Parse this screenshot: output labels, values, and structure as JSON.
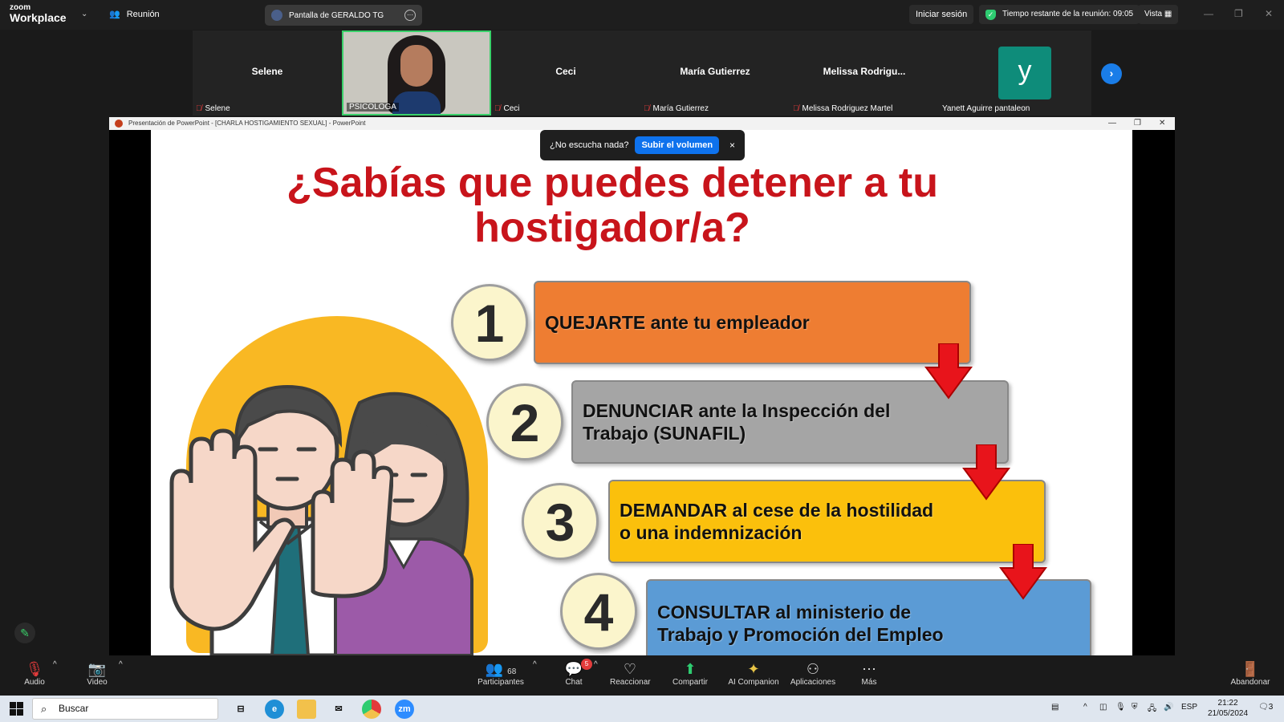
{
  "topbar": {
    "brand_top": "zoom",
    "brand_bottom": "Workplace",
    "meeting_label": "Reunión",
    "share_label": "Pantalla de GERALDO TG",
    "signin_label": "Iniciar sesión",
    "remaining_label": "Tiempo restante de la reunión: 09:05",
    "view_label": "Vista"
  },
  "participants": [
    {
      "name": "Selene",
      "label": "Selene"
    },
    {
      "name": "",
      "label": "PSICOLOGA"
    },
    {
      "name": "Ceci",
      "label": "Ceci"
    },
    {
      "name": "María  Gutierrez",
      "label": "María  Gutierrez"
    },
    {
      "name": "Melissa  Rodrigu...",
      "label": "Melissa Rodriguez Martel"
    },
    {
      "name": "y",
      "label": "Yanett Aguirre pantaleon"
    }
  ],
  "powerpoint": {
    "window_title": "Presentación de PowerPoint - [CHARLA HOSTIGAMIENTO SEXUAL] - PowerPoint"
  },
  "toast": {
    "question": "¿No escucha nada?",
    "button": "Subir el volumen",
    "close": "×"
  },
  "slide": {
    "title_line1": "¿Sabías que puedes detener a tu",
    "title_line2": "hostigador/a?",
    "steps": [
      {
        "number": "1",
        "line1": "QUEJARTE ante tu empleador",
        "line2": "",
        "color": "#ee7d32"
      },
      {
        "number": "2",
        "line1": "DENUNCIAR ante la Inspección del",
        "line2": "Trabajo (SUNAFIL)",
        "color": "#a5a5a5"
      },
      {
        "number": "3",
        "line1": "DEMANDAR al cese de la hostilidad",
        "line2": "o una indemnización",
        "color": "#fbc00c"
      },
      {
        "number": "4",
        "line1": "CONSULTAR al ministerio de",
        "line2": "Trabajo y Promoción del Empleo",
        "color": "#5b9bd5"
      }
    ]
  },
  "toolbar": {
    "audio": "Audio",
    "video": "Video",
    "participants_count": "68",
    "participants": "Participantes",
    "chat": "Chat",
    "chat_badge": "5",
    "react": "Reaccionar",
    "share": "Compartir",
    "ai": "AI Companion",
    "apps": "Aplicaciones",
    "more": "Más",
    "leave": "Abandonar"
  },
  "taskbar": {
    "search_placeholder": "Buscar",
    "lang": "ESP",
    "time": "21:22",
    "date": "21/05/2024",
    "notif_count": "3",
    "zoom_icon": "zm"
  }
}
